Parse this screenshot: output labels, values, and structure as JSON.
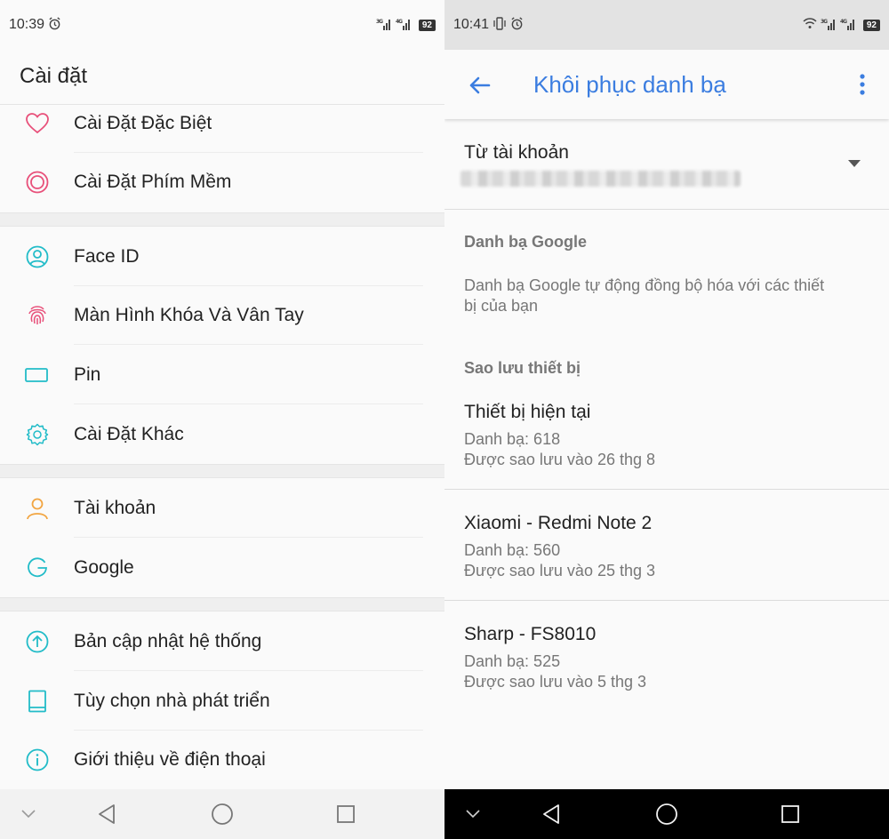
{
  "left": {
    "status": {
      "time": "10:39",
      "battery": "92"
    },
    "title": "Cài đặt",
    "items": [
      {
        "label": "Cài Đặt Đặc Biệt"
      },
      {
        "label": "Cài Đặt Phím Mềm"
      },
      {
        "label": "Face ID"
      },
      {
        "label": "Màn Hình Khóa Và Vân Tay"
      },
      {
        "label": "Pin"
      },
      {
        "label": "Cài Đặt Khác"
      },
      {
        "label": "Tài khoản"
      },
      {
        "label": "Google"
      },
      {
        "label": "Bản cập nhật hệ thống"
      },
      {
        "label": "Tùy chọn nhà phát triển"
      },
      {
        "label": "Giới thiệu về điện thoại"
      }
    ]
  },
  "right": {
    "status": {
      "time": "10:41",
      "battery": "92"
    },
    "title": "Khôi phục danh bạ",
    "account_label": "Từ tài khoản",
    "google_section": {
      "heading": "Danh bạ Google",
      "description": "Danh bạ Google tự động đồng bộ hóa với các thiết bị của bạn"
    },
    "backup_heading": "Sao lưu thiết bị",
    "devices": [
      {
        "name": "Thiết bị hiện tại",
        "count": "Danh bạ: 618",
        "backup": "Được sao lưu vào 26 thg 8"
      },
      {
        "name": "Xiaomi - Redmi Note 2",
        "count": "Danh bạ: 560",
        "backup": "Được sao lưu vào 25 thg 3"
      },
      {
        "name": "Sharp - FS8010",
        "count": "Danh bạ: 525",
        "backup": "Được sao lưu vào 5 thg 3"
      }
    ]
  },
  "colors": {
    "accent_blue": "#3b7de0",
    "icon_pink": "#e8507a",
    "icon_teal": "#22bcc8",
    "icon_orange": "#f2a541"
  }
}
